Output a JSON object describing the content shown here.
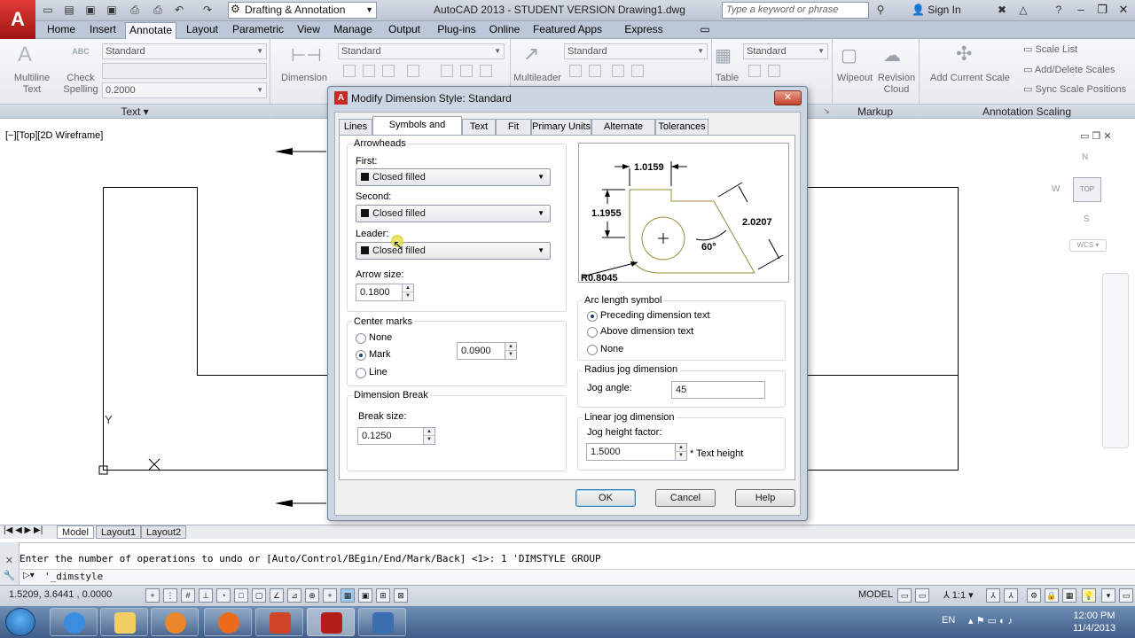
{
  "window": {
    "title": "AutoCAD 2013 - STUDENT VERSION    Drawing1.dwg",
    "workspace": "Drafting & Annotation",
    "search_placeholder": "Type a keyword or phrase",
    "signin": "Sign In"
  },
  "ribbon_tabs": [
    "Home",
    "Insert",
    "Annotate",
    "Layout",
    "Parametric",
    "View",
    "Manage",
    "Output",
    "Plug-ins",
    "Online",
    "Featured Apps",
    "Express Tools"
  ],
  "ribbon": {
    "text_panel": {
      "multiline_line1": "Multiline",
      "multiline_line2": "Text",
      "check_line1": "Check",
      "check_line2": "Spelling",
      "style": "Standard",
      "height": "0.2000",
      "title": "Text",
      "abc": "ABC"
    },
    "dimension": {
      "label": "Dimension",
      "style": "Standard"
    },
    "multileader": {
      "label": "Multileader",
      "style": "Standard"
    },
    "table": {
      "label": "Table",
      "style": "Standard"
    },
    "markup": {
      "wipeout": "Wipeout",
      "revision_line1": "Revision",
      "revision_line2": "Cloud",
      "title": "Markup"
    },
    "annotation_scaling": {
      "add_scale": "Add Current Scale",
      "scale_list": "Scale List",
      "add_delete": "Add/Delete Scales",
      "sync": "Sync Scale Positions",
      "title": "Annotation Scaling"
    }
  },
  "viewport": {
    "label": "[−][Top][2D Wireframe]",
    "ucs_y": "Y",
    "ucs_x": "X"
  },
  "navcube": {
    "n": "N",
    "w": "W",
    "top": "TOP",
    "s": "S",
    "wcs": "WCS"
  },
  "layout_tabs": [
    "Model",
    "Layout1",
    "Layout2"
  ],
  "command": {
    "history": "Enter the number of operations to undo or [Auto/Control/BEgin/End/Mark/Back] <1>: 1 'DIMSTYLE GROUP",
    "current": "'_dimstyle"
  },
  "status": {
    "coords": "1.5209, 3.6441 , 0.0000",
    "model": "MODEL",
    "scale": "1:1"
  },
  "taskbar": {
    "lang": "EN",
    "time": "12:00 PM",
    "date": "11/4/2013"
  },
  "dialog": {
    "title": "Modify Dimension Style: Standard",
    "tabs": [
      "Lines",
      "Symbols and Arrows",
      "Text",
      "Fit",
      "Primary Units",
      "Alternate Units",
      "Tolerances"
    ],
    "arrowheads": {
      "title": "Arrowheads",
      "first_label": "First:",
      "first": "Closed filled",
      "second_label": "Second:",
      "second": "Closed filled",
      "leader_label": "Leader:",
      "leader": "Closed filled",
      "arrow_size_label": "Arrow size:",
      "arrow_size": "0.1800"
    },
    "center_marks": {
      "title": "Center marks",
      "none": "None",
      "mark": "Mark",
      "line": "Line",
      "value": "0.0900"
    },
    "dim_break": {
      "title": "Dimension Break",
      "break_size_label": "Break size:",
      "break_size": "0.1250"
    },
    "preview": {
      "d1": "1.0159",
      "d2": "1.1955",
      "d3": "2.0207",
      "angle": "60°",
      "radius": "R0.8045"
    },
    "arc_length": {
      "title": "Arc length symbol",
      "opt1": "Preceding dimension text",
      "opt2": "Above dimension text",
      "opt3": "None"
    },
    "radius_jog": {
      "title": "Radius jog dimension",
      "jog_angle_label": "Jog angle:",
      "jog_angle": "45"
    },
    "linear_jog": {
      "title": "Linear jog dimension",
      "height_label": "Jog height factor:",
      "height": "1.5000",
      "suffix": "* Text height"
    },
    "buttons": {
      "ok": "OK",
      "cancel": "Cancel",
      "help": "Help"
    }
  }
}
